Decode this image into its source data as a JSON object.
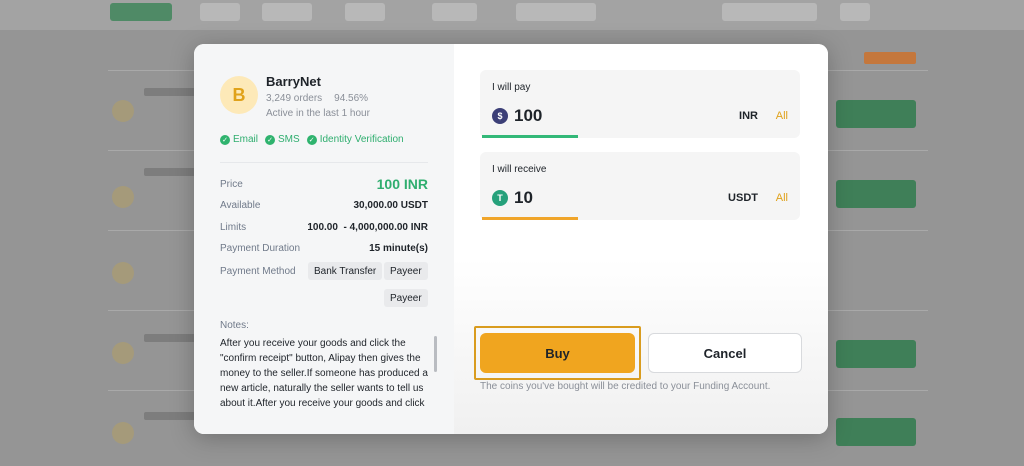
{
  "merchant": {
    "avatar_letter": "B",
    "name": "BarryNet",
    "orders": "3,249 orders",
    "completion": "94.56%",
    "active": "Active in the last 1 hour",
    "verifications": [
      "Email",
      "SMS",
      "Identity Verification"
    ]
  },
  "details": {
    "price_label": "Price",
    "price_value": "100 INR",
    "available_label": "Available",
    "available_value": "30,000.00 USDT",
    "limits_label": "Limits",
    "limits_min": "100.00",
    "limits_max": "- 4,000,000.00 INR",
    "duration_label": "Payment Duration",
    "duration_value": "15 minute(s)",
    "method_label": "Payment Method",
    "methods": [
      "Bank Transfer",
      "Payeer",
      "Payeer"
    ]
  },
  "notes": {
    "label": "Notes:",
    "text": "After you receive your goods and click the \"confirm receipt\" button, Alipay then gives the money to the seller.If someone has produced a new article, naturally the seller wants to tell us about it.After you receive your goods and click"
  },
  "pay": {
    "label": "I will pay",
    "amount": "100",
    "coin_icon": "$",
    "currency": "INR",
    "all": "All",
    "color": "#33b878"
  },
  "receive": {
    "label": "I will receive",
    "amount": "10",
    "coin_icon": "T",
    "currency": "USDT",
    "all": "All",
    "color": "#f0a52a"
  },
  "actions": {
    "buy": "Buy",
    "cancel": "Cancel",
    "footnote": "The coins you've bought will be credited to your Funding Account."
  },
  "colors": {
    "accent": "#f0a51f",
    "success": "#2fae6f"
  }
}
